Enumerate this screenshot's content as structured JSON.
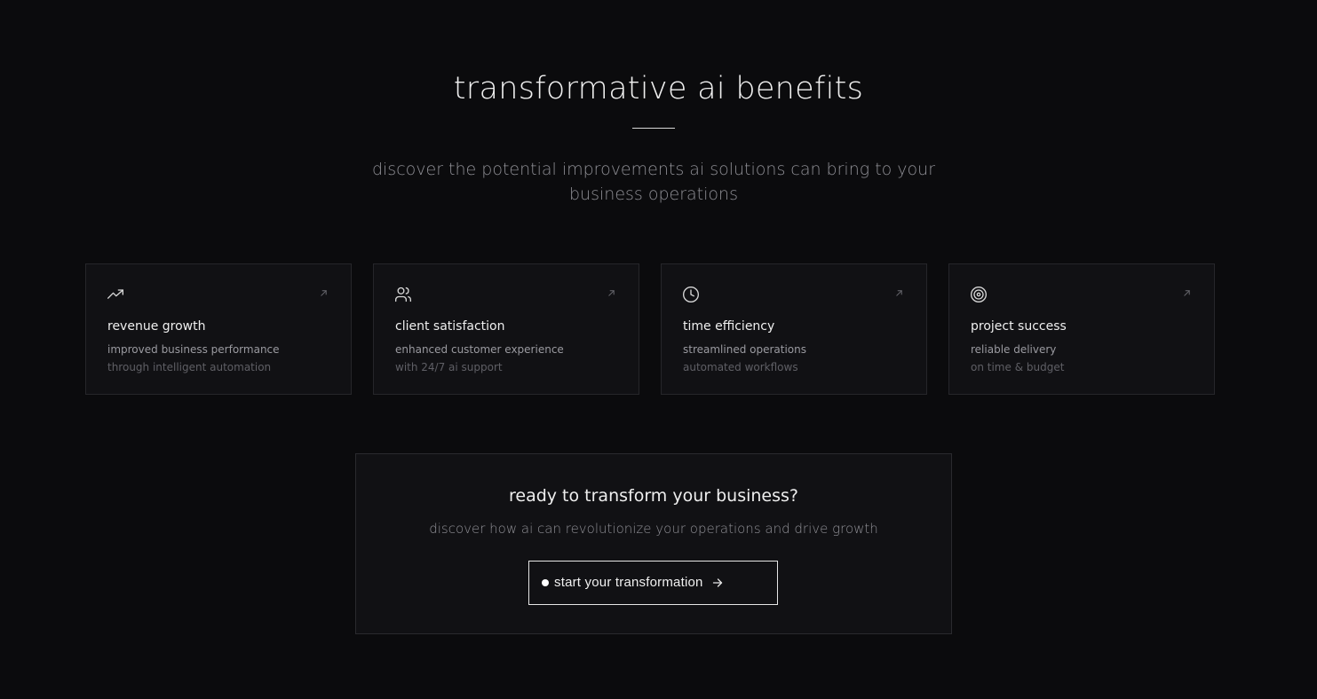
{
  "header": {
    "title": "transformative ai benefits",
    "subtitle": "discover the potential improvements ai solutions can bring to your business operations"
  },
  "cards": [
    {
      "icon": "trending-up-icon",
      "title": "revenue growth",
      "description": "improved business performance",
      "sub": "through intelligent automation"
    },
    {
      "icon": "users-icon",
      "title": "client satisfaction",
      "description": "enhanced customer experience",
      "sub": "with 24/7 ai support"
    },
    {
      "icon": "clock-icon",
      "title": "time efficiency",
      "description": "streamlined operations",
      "sub": "automated workflows"
    },
    {
      "icon": "target-icon",
      "title": "project success",
      "description": "reliable delivery",
      "sub": "on time & budget"
    }
  ],
  "cta": {
    "title": "ready to transform your business?",
    "description": "discover how ai can revolutionize your operations and drive growth",
    "button_label": "start your transformation"
  },
  "colors": {
    "background": "#0b0b0d",
    "card_background": "#111114",
    "card_border": "#26262a",
    "text_primary": "#efefef",
    "text_secondary": "#9a9aa0",
    "text_muted": "#5f5f65"
  }
}
